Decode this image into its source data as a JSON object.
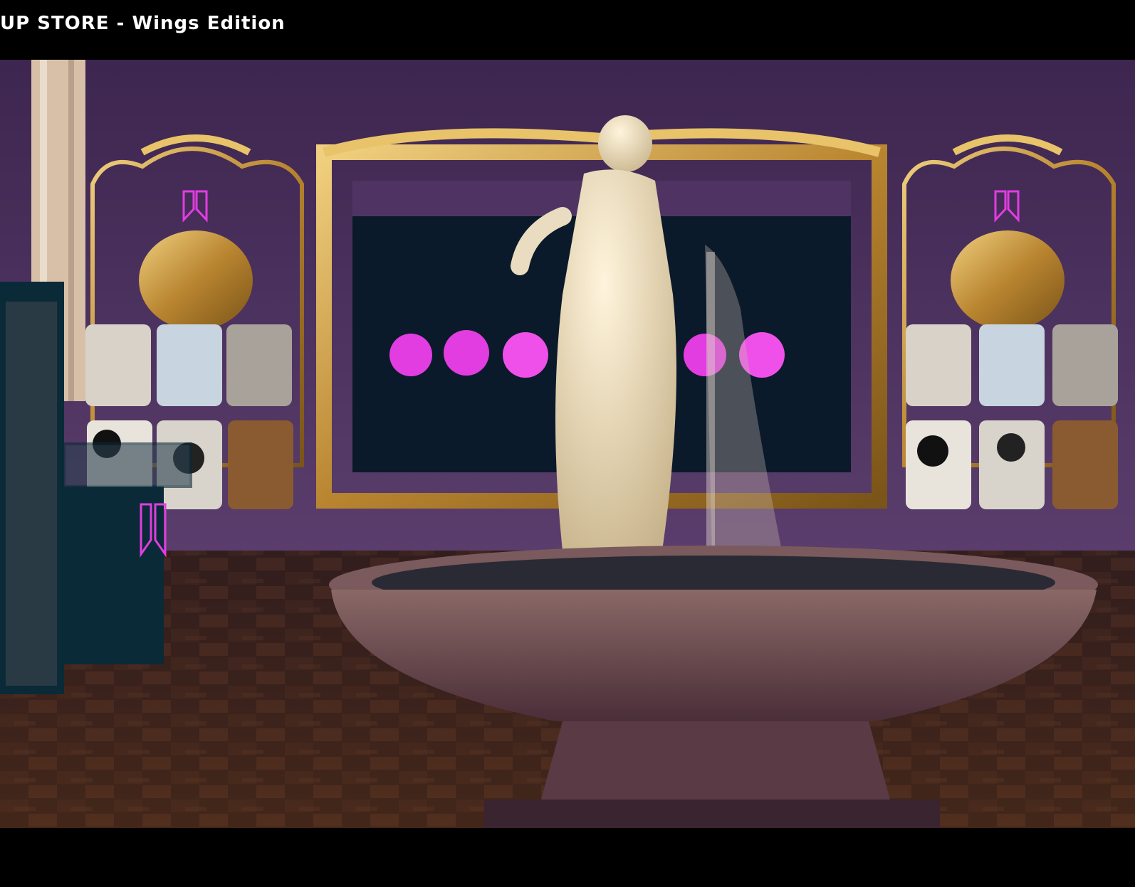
{
  "header": {
    "title": "UP STORE - Wings Edition"
  },
  "scene": {
    "logo_mark": "BTS-style neon logo",
    "colors": {
      "wall": "#4f3463",
      "wall_dark": "#3a2448",
      "gold": "#c9963a",
      "gold_light": "#e8c36a",
      "neon_pink": "#e23de0",
      "mirror": "#0a1a2a",
      "floor": "#3a2218",
      "fountain": "#6b4a4e",
      "statue": "#e9dcc0"
    }
  }
}
